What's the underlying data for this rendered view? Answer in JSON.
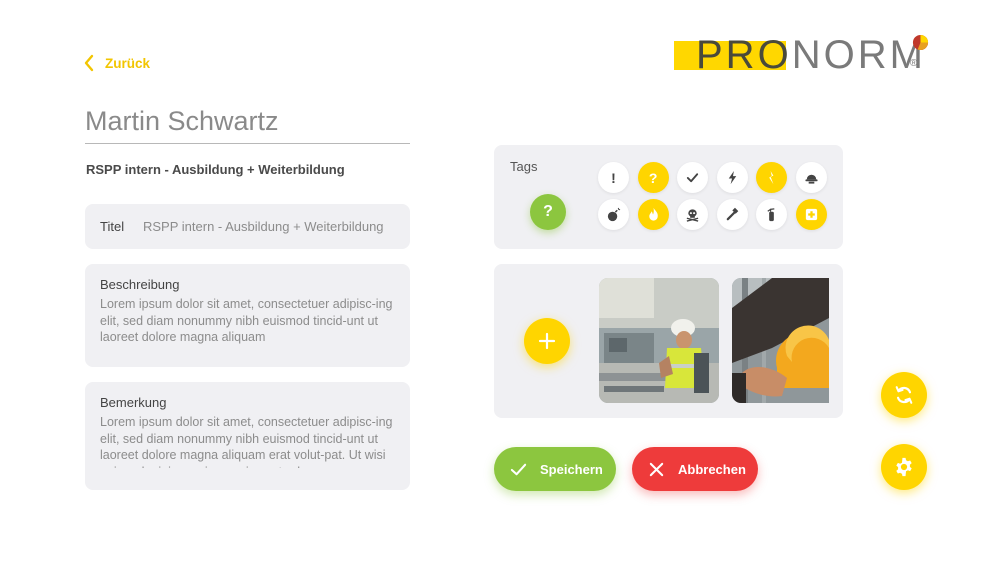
{
  "nav": {
    "back_label": "Zurück"
  },
  "logo": {
    "text_highlight": "PRO",
    "text_rest": "NORM",
    "registered": "®",
    "colors": {
      "bar": "#ffd700",
      "dot_red": "#c0392b",
      "dot_yellow": "#ffd700"
    }
  },
  "person": {
    "name": "Martin Schwartz",
    "subtitle": "RSPP intern - Ausbildung + Weiterbildung"
  },
  "form": {
    "title": {
      "label": "Titel",
      "value": "RSPP intern - Ausbildung + Weiterbildung"
    },
    "description": {
      "label": "Beschreibung",
      "value": "Lorem ipsum dolor sit amet, consectetuer adipisc-ing elit, sed diam nonummy nibh euismod tincid-unt ut laoreet dolore magna aliquam"
    },
    "remark": {
      "label": "Bemerkung",
      "value": "Lorem ipsum dolor sit amet, consectetuer adipisc-ing elit, sed diam nonummy nibh euismod tincid-unt ut laoreet dolore magna aliquam erat volut-pat. Ut wisi enim ad minim veniam, quis nostrud"
    }
  },
  "tags": {
    "label": "Tags",
    "selected": "?",
    "items": [
      {
        "icon": "exclamation-icon",
        "glyph": "!",
        "active": false
      },
      {
        "icon": "question-icon",
        "glyph": "?",
        "active": true
      },
      {
        "icon": "check-icon",
        "glyph": "",
        "active": false
      },
      {
        "icon": "lightning-icon",
        "glyph": "",
        "active": false
      },
      {
        "icon": "electric-hazard-icon",
        "glyph": "",
        "active": true
      },
      {
        "icon": "hard-hat-icon",
        "glyph": "",
        "active": false
      },
      {
        "icon": "bomb-icon",
        "glyph": "",
        "active": false
      },
      {
        "icon": "fire-icon",
        "glyph": "",
        "active": true
      },
      {
        "icon": "skull-icon",
        "glyph": "",
        "active": false
      },
      {
        "icon": "hammer-icon",
        "glyph": "",
        "active": false
      },
      {
        "icon": "fire-extinguisher-icon",
        "glyph": "",
        "active": false
      },
      {
        "icon": "first-aid-icon",
        "glyph": "",
        "active": true
      }
    ]
  },
  "media": {
    "add_icon": "plus-icon",
    "photos": [
      "worker-in-factory-photo",
      "hard-hat-photo"
    ]
  },
  "actions": {
    "save_label": "Speichern",
    "cancel_label": "Abbrechen"
  },
  "colors": {
    "accent": "#ffd500",
    "save": "#8cc63f",
    "cancel": "#ee3b3b",
    "panel": "#f0f0f3"
  }
}
